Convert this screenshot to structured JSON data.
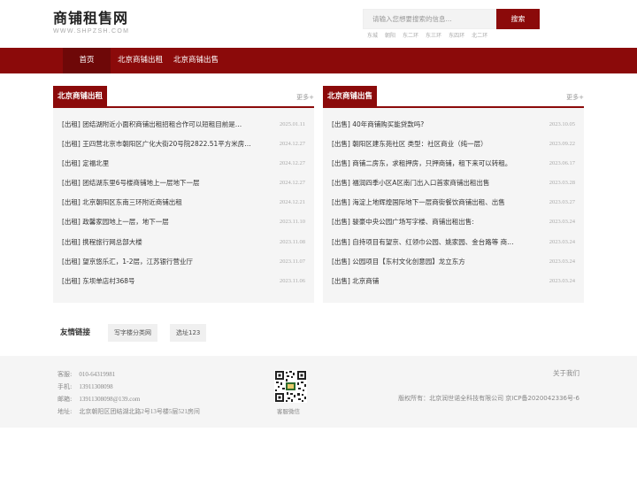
{
  "header": {
    "logo_title": "商铺租售网",
    "logo_sub": "WWW.SHPZSH.COM",
    "search_placeholder": "请输入您想要搜索的信息...",
    "search_button": "搜索",
    "hot_tags": [
      "东城",
      "朝阳",
      "东二环",
      "东三环",
      "东四环",
      "北二环"
    ]
  },
  "nav": {
    "home": "首页",
    "rent": "北京商铺出租",
    "sale": "北京商铺出售"
  },
  "rent_panel": {
    "title": "北京商铺出租",
    "more": "更多+",
    "rows": [
      {
        "title": "[出租] 团结湖附近小面积商铺出租招租合作可以短租目前是…",
        "date": "2025.01.11"
      },
      {
        "title": "[出租] 王四营北京市朝阳区广化大街20号院2822.51平方米房…",
        "date": "2024.12.27"
      },
      {
        "title": "[出租] 定福北里",
        "date": "2024.12.27"
      },
      {
        "title": "[出租] 团结湖东里6号楼商铺地上一层地下一层",
        "date": "2024.12.27"
      },
      {
        "title": "[出租] 北京朝阳区东南三环附近商铺出租",
        "date": "2024.12.21"
      },
      {
        "title": "[出租] 政馨家园地上一层，地下一层",
        "date": "2023.11.10"
      },
      {
        "title": "[出租] 携程旅行网总部大楼",
        "date": "2023.11.08"
      },
      {
        "title": "[出租] 望京悠乐汇，1-2层，江苏银行营业厅",
        "date": "2023.11.07"
      },
      {
        "title": "[出租] 东坝单店村368号",
        "date": "2023.11.06"
      }
    ]
  },
  "sale_panel": {
    "title": "北京商铺出售",
    "more": "更多+",
    "rows": [
      {
        "title": "[出售] 40年商铺购买能贷款吗?",
        "date": "2023.10.05"
      },
      {
        "title": "[出售] 朝阳区建东苑社区 类型：社区商业（纯一层）",
        "date": "2023.09.22"
      },
      {
        "title": "[出售] 商铺二房东，求租押房，只押商铺，租下来可以转租。",
        "date": "2023.06.17"
      },
      {
        "title": "[出售] 福润四季小区A区南门出入口首家商铺出租出售",
        "date": "2023.03.28"
      },
      {
        "title": "[出售] 海淀上地辉煌国际地下一层商街餐饮商铺出租、出售",
        "date": "2023.03.27"
      },
      {
        "title": "[出售] 骏豪中央公园广场写字楼、商铺出租出售:",
        "date": "2023.03.24"
      },
      {
        "title": "[出售] 自持项目有望京、红领巾公园、姚家园、金台路等 商…",
        "date": "2023.03.24"
      },
      {
        "title": "[出售] 公园项目【东村文化创意园】龙立东方",
        "date": "2023.03.24"
      },
      {
        "title": "[出售] 北京商铺",
        "date": "2023.03.24"
      }
    ]
  },
  "links": {
    "label": "友情链接",
    "items": [
      "写字楼分类网",
      "选址123"
    ]
  },
  "footer": {
    "contacts": [
      {
        "label": "客服:",
        "value": "010-64319981"
      },
      {
        "label": "手机:",
        "value": "13911308098"
      },
      {
        "label": "邮箱:",
        "value": "13911308098@139.com"
      },
      {
        "label": "地址:",
        "value": "北京朝阳区团结湖北路2号13号楼5层521房间"
      }
    ],
    "qr_caption": "客服微信",
    "about": "关于我们",
    "copyright": "版权所有：北京润世诺全科技有限公司 京ICP备2020042336号-6"
  },
  "colors": {
    "brand": "#8b0a0a",
    "nav_active": "#6e0808",
    "panel_bg": "#f5f5f5"
  }
}
